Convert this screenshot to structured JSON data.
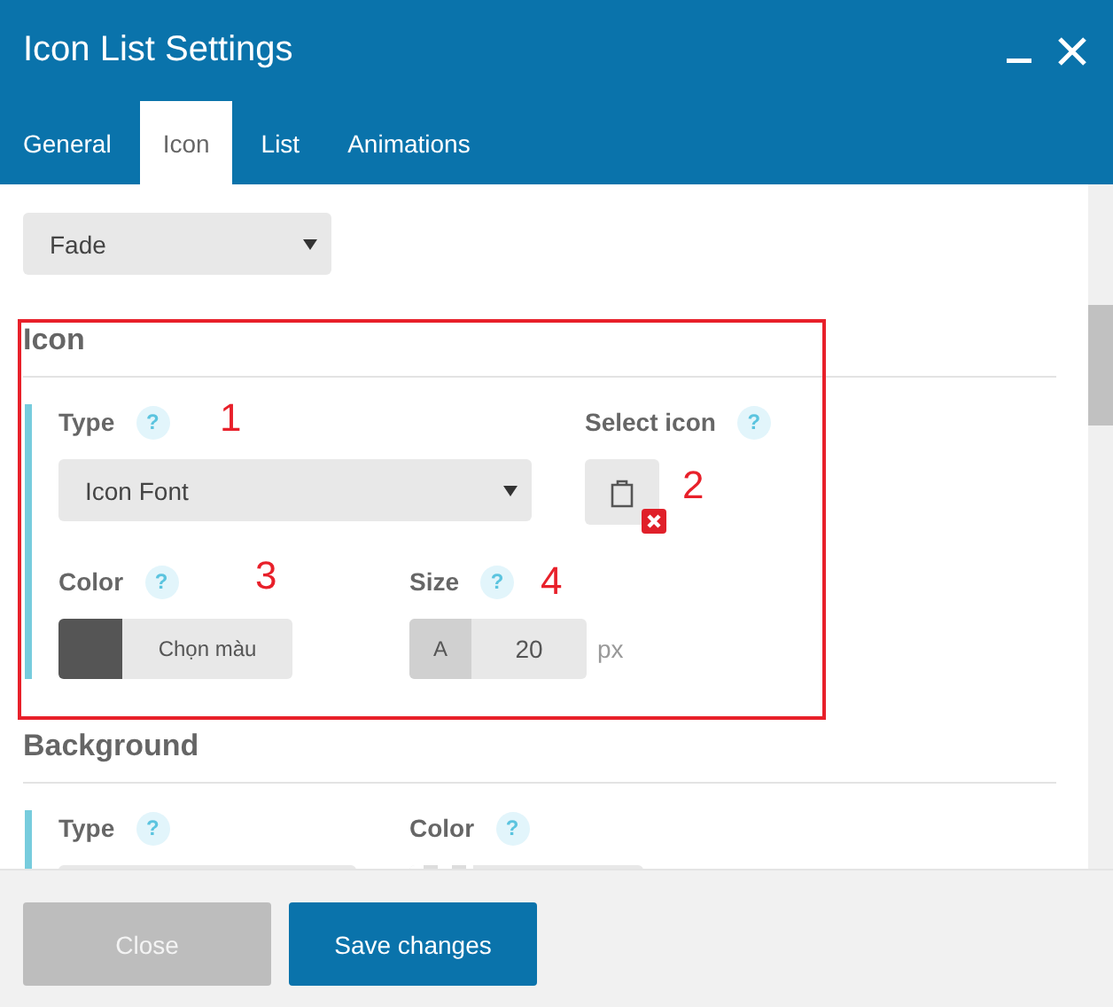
{
  "window": {
    "title": "Icon List Settings"
  },
  "tabs": [
    {
      "label": "General",
      "selected": false
    },
    {
      "label": "Icon",
      "selected": true
    },
    {
      "label": "List",
      "selected": false
    },
    {
      "label": "Animations",
      "selected": false
    }
  ],
  "hover_effect": {
    "value": "Fade"
  },
  "sections": [
    {
      "heading": "Icon",
      "rows": [
        [
          {
            "kind": "select",
            "label": "Type",
            "help": "?",
            "value": "Icon Font"
          },
          {
            "kind": "icon_picker",
            "label": "Select icon",
            "help": "?",
            "removable": true
          }
        ],
        [
          {
            "kind": "color",
            "label": "Color",
            "help": "?",
            "color": "#555555",
            "button": "Chọn màu"
          },
          {
            "kind": "size",
            "label": "Size",
            "help": "?",
            "prefix": "A",
            "value": "20",
            "unit": "px"
          }
        ]
      ]
    },
    {
      "heading": "Background",
      "rows": [
        [
          {
            "kind": "select",
            "label": "Type",
            "help": "?"
          },
          {
            "kind": "color",
            "label": "Color",
            "help": "?"
          }
        ]
      ]
    }
  ],
  "footer": {
    "buttons": [
      {
        "label": "Close",
        "disabled": true
      },
      {
        "label": "Save changes",
        "disabled": false
      }
    ]
  },
  "annotations": {
    "numbers": [
      "1",
      "2",
      "3",
      "4"
    ]
  }
}
